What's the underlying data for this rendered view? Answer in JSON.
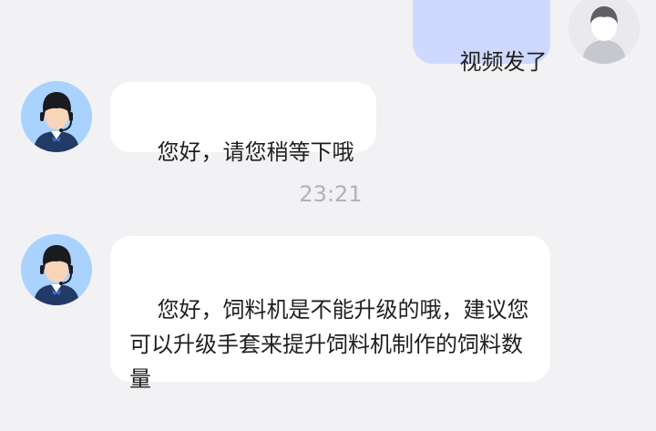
{
  "messages": [
    {
      "sender": "user",
      "text": "视频发了"
    },
    {
      "sender": "agent",
      "text": "您好，请您稍等下哦"
    },
    {
      "sender": "agent",
      "text": "您好，饲料机是不能升级的哦，建议您可以升级手套来提升饲料机制作的饲料数量"
    }
  ],
  "timestamp": "23:21",
  "colors": {
    "background": "#f2f2f4",
    "user_bubble": "#cfd9ff",
    "agent_bubble": "#ffffff",
    "timestamp_text": "#b2b2b5",
    "agent_avatar_bg": "#a9d2ff",
    "user_avatar_bg": "#e9e9ee"
  },
  "icons": {
    "user_avatar": "user-avatar-icon",
    "agent_avatar": "customer-service-agent-icon"
  }
}
